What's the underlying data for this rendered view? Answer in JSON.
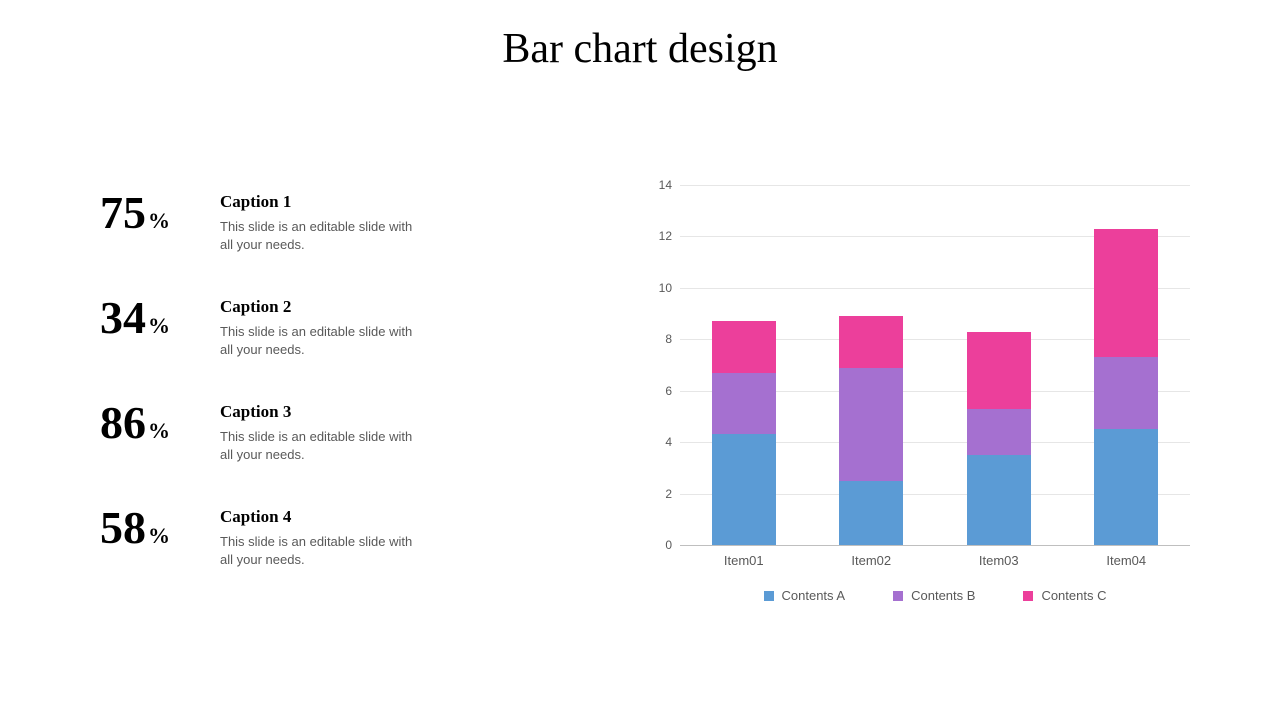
{
  "title": "Bar chart design",
  "stats": [
    {
      "pct": "75",
      "sym": "%",
      "caption": "Caption 1",
      "body": "This slide is an editable slide with all your needs."
    },
    {
      "pct": "34",
      "sym": "%",
      "caption": "Caption 2",
      "body": "This slide is an editable slide with all your needs."
    },
    {
      "pct": "86",
      "sym": "%",
      "caption": "Caption 3",
      "body": "This slide is an editable slide with all your needs."
    },
    {
      "pct": "58",
      "sym": "%",
      "caption": "Caption 4",
      "body": "This slide is an editable slide with all your needs."
    }
  ],
  "chart_data": {
    "type": "bar",
    "stacked": true,
    "categories": [
      "Item01",
      "Item02",
      "Item03",
      "Item04"
    ],
    "series": [
      {
        "name": "Contents A",
        "color": "#5b9bd5",
        "values": [
          4.3,
          2.5,
          3.5,
          4.5
        ]
      },
      {
        "name": "Contents B",
        "color": "#a570d0",
        "values": [
          2.4,
          4.4,
          1.8,
          2.8
        ]
      },
      {
        "name": "Contents C",
        "color": "#ec3f9b",
        "values": [
          2.0,
          2.0,
          3.0,
          5.0
        ]
      }
    ],
    "ylim": [
      0,
      14
    ],
    "yticks": [
      0,
      2,
      4,
      6,
      8,
      10,
      12,
      14
    ],
    "title": "",
    "xlabel": "",
    "ylabel": ""
  }
}
